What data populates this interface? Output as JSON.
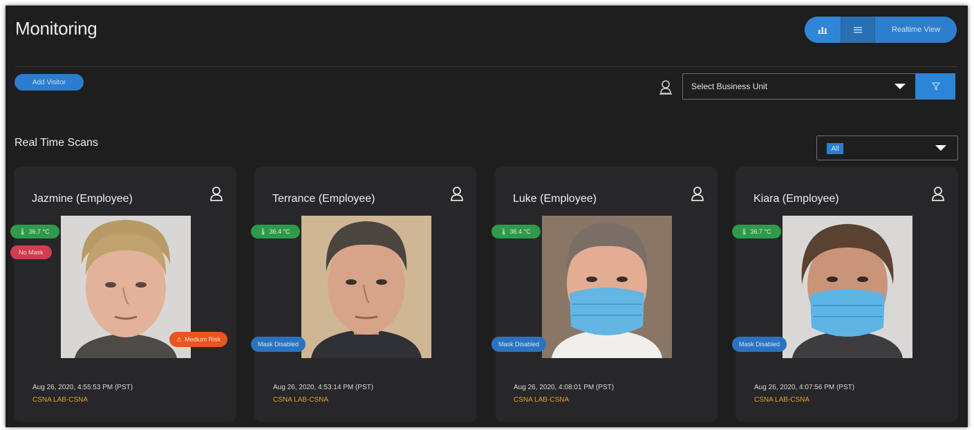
{
  "header": {
    "title": "Monitoring",
    "view_toggle": {
      "chart_icon": "bar-chart-icon",
      "list_icon": "list-icon",
      "realtime_label": "Realtime View"
    }
  },
  "toolbar": {
    "add_visitor_label": "Add Visitor",
    "business_unit_icon": "person-pin-icon",
    "business_unit_placeholder": "Select Business Unit",
    "filter_icon": "filter-icon"
  },
  "scans": {
    "section_title": "Real Time Scans",
    "filter_value": "All",
    "cards": [
      {
        "name": "Jazmine (Employee)",
        "temperature": "36.7 °C",
        "mask_status": "No Mask",
        "risk": "Medium Risk",
        "timestamp": "Aug 26, 2020, 4:55:53 PM (PST)",
        "location": "CSNA LAB-CSNA"
      },
      {
        "name": "Terrance (Employee)",
        "temperature": "36.4 °C",
        "mask_status": "Mask Disabled",
        "timestamp": "Aug 26, 2020, 4:53:14 PM (PST)",
        "location": "CSNA LAB-CSNA"
      },
      {
        "name": "Luke (Employee)",
        "temperature": "36.4 °C",
        "mask_status": "Mask Disabled",
        "timestamp": "Aug 26, 2020, 4:08:01 PM (PST)",
        "location": "CSNA LAB-CSNA"
      },
      {
        "name": "Kiara (Employee)",
        "temperature": "36.7 °C",
        "mask_status": "Mask Disabled",
        "timestamp": "Aug 26, 2020, 4:07:56 PM (PST)",
        "location": "CSNA LAB-CSNA"
      }
    ]
  },
  "colors": {
    "background": "#1e1e1f",
    "card": "#272729",
    "accent_blue": "#2b7dd0",
    "temp_green": "#2f9a4a",
    "no_mask_red": "#cf3d4e",
    "risk_orange": "#e8551f",
    "location_gold": "#e0a12a"
  }
}
